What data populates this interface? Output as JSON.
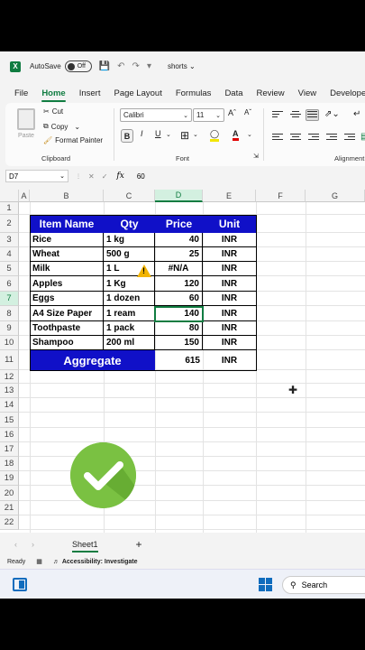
{
  "titlebar": {
    "autosave_label": "AutoSave",
    "autosave_state": "Off",
    "filename": "shorts"
  },
  "tabs": [
    "File",
    "Home",
    "Insert",
    "Page Layout",
    "Formulas",
    "Data",
    "Review",
    "View",
    "Developer"
  ],
  "ribbon": {
    "paste": "Paste",
    "cut": "Cut",
    "copy": "Copy",
    "format_painter": "Format Painter",
    "clipboard_label": "Clipboard",
    "font_name": "Calibri",
    "font_size": "11",
    "bold": "B",
    "italic": "I",
    "underline": "U",
    "font_label": "Font",
    "alignment_label": "Alignment"
  },
  "formula_bar": {
    "cell_ref": "D7",
    "fx": "fx",
    "value": "60"
  },
  "columns": [
    "A",
    "B",
    "C",
    "D",
    "E",
    "F",
    "G"
  ],
  "rows": [
    "1",
    "2",
    "3",
    "4",
    "5",
    "6",
    "7",
    "8",
    "9",
    "10",
    "11",
    "12",
    "13",
    "14",
    "15",
    "16",
    "17",
    "18",
    "19",
    "20",
    "21",
    "22"
  ],
  "table": {
    "headers": [
      "Item Name",
      "Qty",
      "Price",
      "Unit"
    ],
    "rows": [
      [
        "Rice",
        "1 kg",
        "40",
        "INR"
      ],
      [
        "Wheat",
        "500 g",
        "25",
        "INR"
      ],
      [
        "Milk",
        "1 L",
        "#N/A",
        "INR"
      ],
      [
        "Apples",
        "1 Kg",
        "120",
        "INR"
      ],
      [
        "Eggs",
        "1 dozen",
        "60",
        "INR"
      ],
      [
        "A4 Size Paper",
        "1 ream",
        "140",
        "INR"
      ],
      [
        "Toothpaste",
        "1 pack",
        "80",
        "INR"
      ],
      [
        "Shampoo",
        "200 ml",
        "150",
        "INR"
      ]
    ],
    "aggregate_label": "Aggregate",
    "aggregate_value": "615",
    "aggregate_unit": "INR"
  },
  "sheet_tab": "Sheet1",
  "add_sheet": "+",
  "status": {
    "ready": "Ready",
    "accessibility": "Accessibility: Investigate"
  },
  "taskbar": {
    "search": "Search"
  },
  "colors": {
    "accent": "#107c41",
    "table_header": "#1010c8",
    "check": "#7ac142",
    "warning": "#f2b400"
  },
  "icons": [
    "excel-logo-icon",
    "save-icon",
    "undo-icon",
    "redo-icon",
    "cut-icon",
    "copy-icon",
    "format-painter-icon",
    "warning-icon",
    "checkmark-icon",
    "windows-start-icon",
    "search-icon"
  ]
}
